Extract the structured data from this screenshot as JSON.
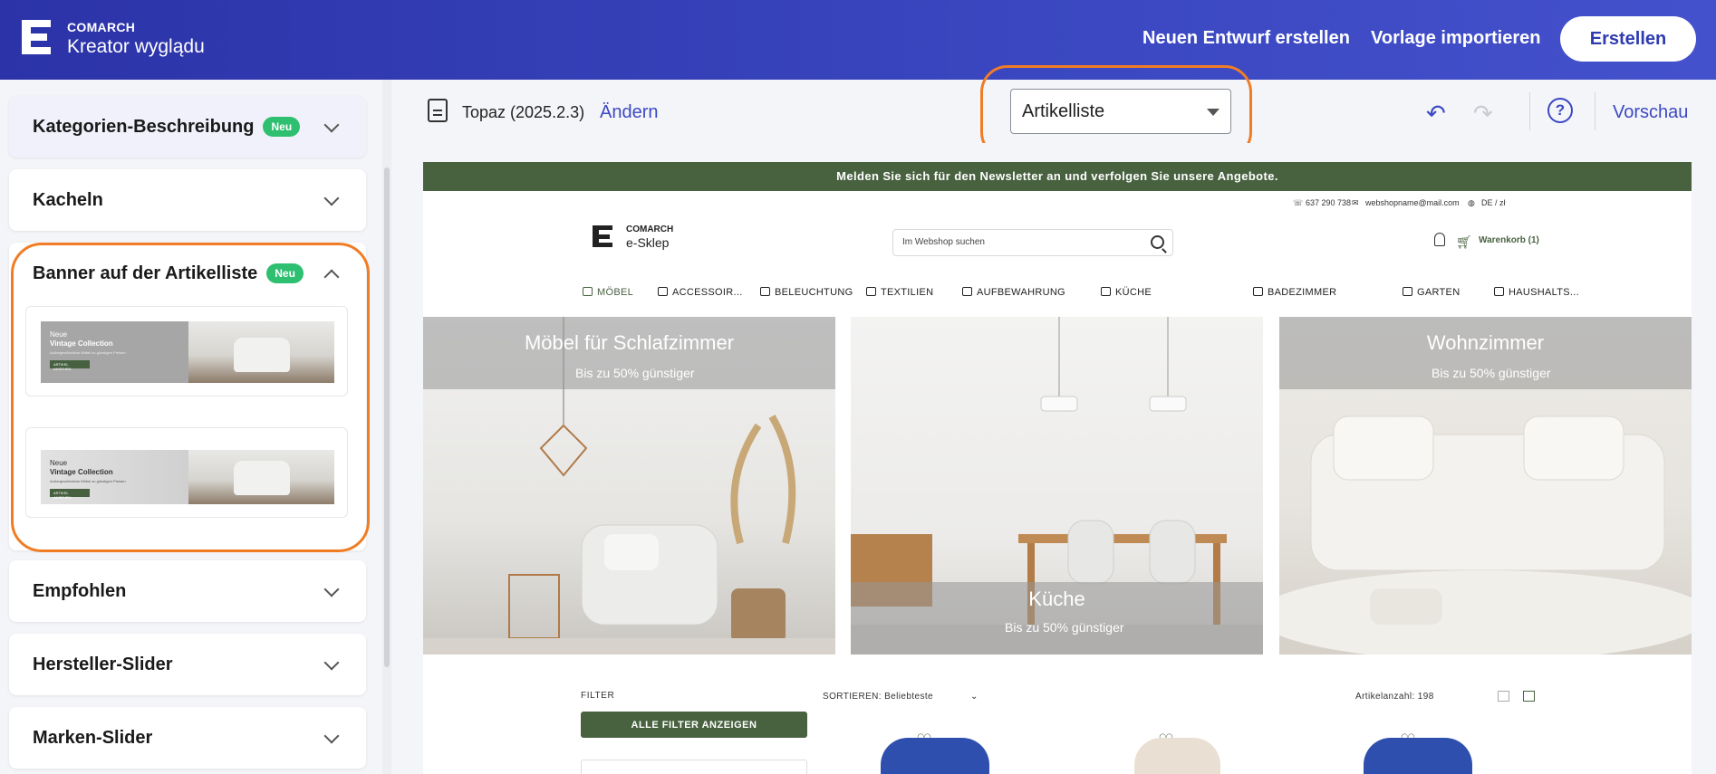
{
  "header": {
    "brand_small": "COMARCH",
    "brand_big": "Kreator wyglądu",
    "new_draft": "Neuen Entwurf erstellen",
    "import_template": "Vorlage importieren",
    "create_button": "Erstellen"
  },
  "sidebar": {
    "badge_new": "Neu",
    "items": [
      {
        "label": "Kategorien-Beschreibung",
        "badge": "Neu"
      },
      {
        "label": "Kacheln"
      },
      {
        "label": "Banner auf der Artikelliste",
        "badge": "Neu"
      },
      {
        "label": "Empfohlen"
      },
      {
        "label": "Hersteller-Slider"
      },
      {
        "label": "Marken-Slider"
      }
    ],
    "thumbnails": [
      {
        "line1": "Neue",
        "line2": "Vintage Collection",
        "line3": "Außergewöhnliche Möbel zu günstigen Preisen",
        "button": "ARTIKEL ANSEHEN"
      },
      {
        "line1": "Neue",
        "line2": "Vintage Collection",
        "line3": "Außergewöhnliche Möbel zu günstigen Preisen",
        "button": "ARTIKEL ANSEHEN"
      }
    ]
  },
  "toolbar": {
    "theme": "Topaz (2025.2.3)",
    "change": "Ändern",
    "page_select": "Artikelliste",
    "undo_icon": "undo-icon",
    "redo_icon": "redo-icon",
    "help": "?",
    "preview": "Vorschau"
  },
  "shop": {
    "newsletter": "Melden Sie sich für den Newsletter an und verfolgen Sie unsere Angebote.",
    "phone": "637 290 738",
    "email": "webshopname@mail.com",
    "lang": "DE / zł",
    "brand_small": "COMARCH",
    "brand_big": "e-Sklep",
    "search_placeholder": "Im Webshop suchen",
    "cart": "Warenkorb (1)",
    "menu": [
      "MÖBEL",
      "ACCESSOIR...",
      "BELEUCHTUNG",
      "TEXTILIEN",
      "AUFBEWAHRUNG",
      "KÜCHE",
      "BADEZIMMER",
      "GARTEN",
      "HAUSHALTS..."
    ],
    "tiles": [
      {
        "title": "Möbel für Schlafzimmer",
        "subtitle": "Bis zu 50% günstiger"
      },
      {
        "title": "Küche",
        "subtitle": "Bis zu 50% günstiger"
      },
      {
        "title": "Wohnzimmer",
        "subtitle": "Bis zu 50% günstiger"
      }
    ],
    "filter_label": "FILTER",
    "filter_button": "ALLE FILTER ANZEIGEN",
    "sort_label": "SORTIEREN: Beliebteste",
    "count_label": "Artikelanzahl: 198"
  },
  "colors": {
    "header": "#3a47c0",
    "accent": "#3b48c4",
    "badge": "#2fbf71",
    "highlight": "#f07d25",
    "shop_green": "#486240"
  }
}
